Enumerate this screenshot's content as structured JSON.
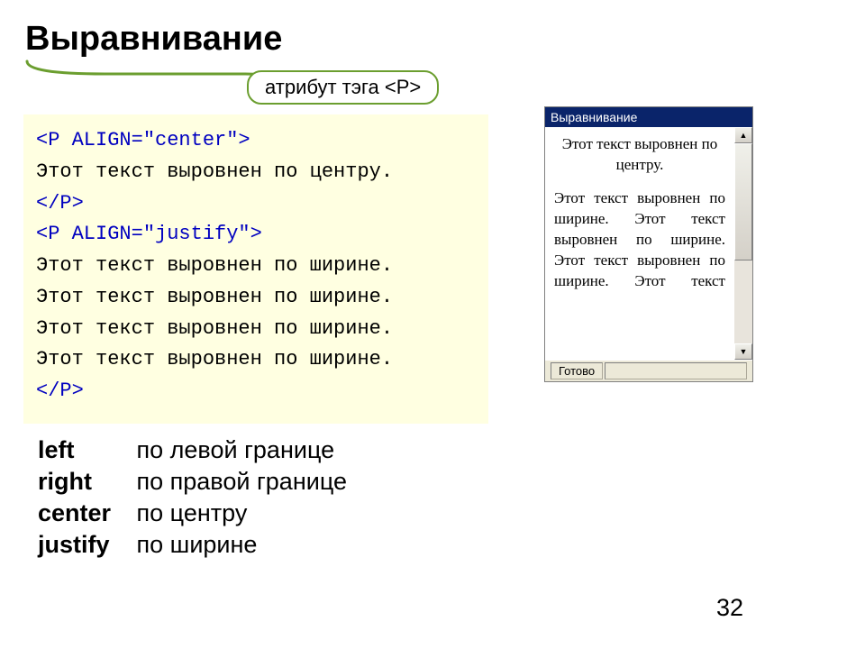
{
  "title": "Выравнивание",
  "callout": "атрибут тэга <P>",
  "code": {
    "line1": "<P ALIGN=\"center\">",
    "line2": "Этот текст выровнен по центру.",
    "line3": "</P>",
    "line4": "<P ALIGN=\"justify\">",
    "line5": "Этот текст выровнен по ширине.",
    "line6": "Этот текст выровнен по ширине.",
    "line7": "Этот текст выровнен по ширине.",
    "line8": "Этот текст выровнен по ширине.",
    "line9": "</P>"
  },
  "browser": {
    "title": "Выравнивание",
    "centered_text": "Этот текст выровнен по центру.",
    "justified_text": "Этот текст выровнен по ширине. Этот текст выровнен по ширине. Этот текст выровнен по ширине. Этот текст",
    "status": "Готово"
  },
  "align_list": {
    "left_key": "left",
    "left_desc": "по левой границе",
    "right_key": "right",
    "right_desc": "по правой границе",
    "center_key": "center",
    "center_desc": "по центру",
    "justify_key": "justify",
    "justify_desc": "по ширине"
  },
  "page_number": "32"
}
